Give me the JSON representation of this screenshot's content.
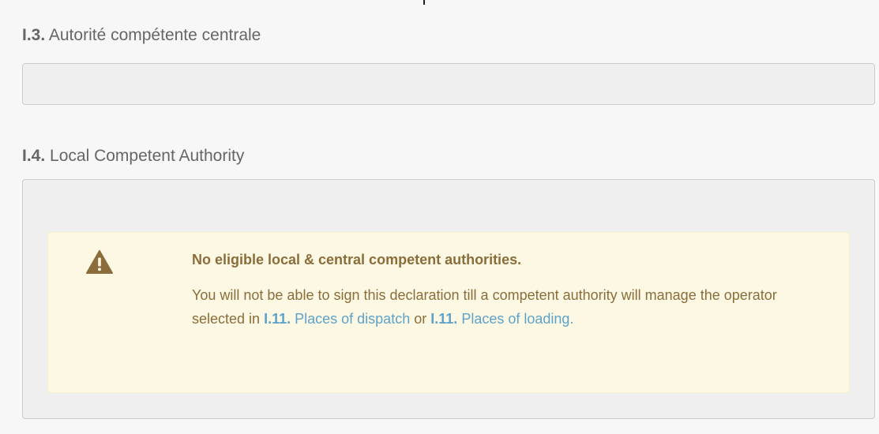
{
  "section_13": {
    "code": "I.3.",
    "label": "Autorité compétente centrale",
    "value": ""
  },
  "section_14": {
    "code": "I.4.",
    "label": "Local Competent Authority"
  },
  "alert": {
    "icon": "warning-triangle-icon",
    "title": "No eligible local & central competent authorities.",
    "message_part1": "You will not be able to sign this declaration till a competent authority will manage the operator selected in",
    "link1_code": "I.11.",
    "link1_text": "Places of dispatch",
    "connector": "or",
    "link2_code": "I.11.",
    "link2_text": "Places of loading",
    "message_end": "."
  },
  "colors": {
    "page_background": "#f7f7f7",
    "field_background": "#efefef",
    "field_border": "#cccccc",
    "alert_background": "#fcf8e3",
    "alert_text": "#8a6d3b",
    "link": "#5ea2c9"
  }
}
